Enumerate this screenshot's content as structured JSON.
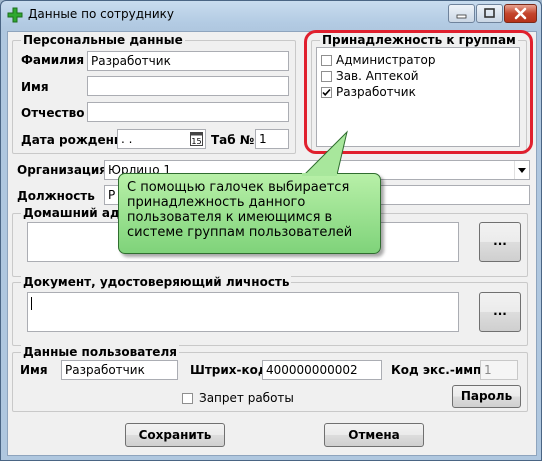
{
  "window": {
    "title": "Данные по сотруднику"
  },
  "personal": {
    "title": "Персональные данные",
    "surname_label": "Фамилия",
    "surname_value": "Разработчик",
    "name_label": "Имя",
    "name_value": "",
    "patronymic_label": "Отчество",
    "patronymic_value": "",
    "birth_label": "Дата рождения",
    "birth_value": " .  .",
    "tab_label": "Таб №",
    "tab_value": "1"
  },
  "groups": {
    "title": "Принадлежность к группам",
    "items": [
      {
        "label": "Администратор",
        "checked": false
      },
      {
        "label": "Зав. Аптекой",
        "checked": false
      },
      {
        "label": "Разработчик",
        "checked": true
      }
    ]
  },
  "org": {
    "label": "Организация",
    "value": "Юрлицо 1"
  },
  "position": {
    "label": "Должность",
    "value": "Р"
  },
  "address": {
    "title": "Домашний адрес",
    "value": "",
    "browse_label": "..."
  },
  "document": {
    "title": "Документ, удостоверяющий личность",
    "value": "",
    "browse_label": "..."
  },
  "user": {
    "title": "Данные пользователя",
    "name_label": "Имя",
    "name_value": "Разработчик",
    "barcode_label": "Штрих-код",
    "barcode_value": "400000000002",
    "code_label": "Код экс.-имп.",
    "code_value": "1",
    "ban_label": "Запрет работы",
    "ban_checked": false,
    "password_button": "Пароль"
  },
  "footer": {
    "save_button": "Сохранить",
    "cancel_button": "Отмена"
  },
  "callout": {
    "lines": [
      "С помощью галочек выбирается",
      "принадлежность данного",
      "пользователя к имеющимся в",
      "системе группам пользователей"
    ]
  },
  "colors": {
    "callout_fill": "#8fdc86",
    "highlight_ring": "#e0202e"
  }
}
